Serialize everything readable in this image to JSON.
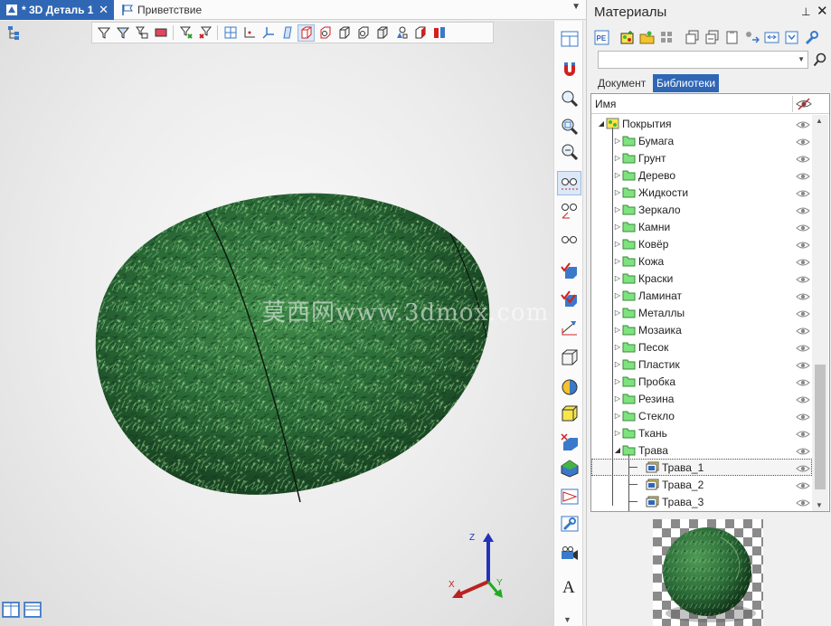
{
  "tabs": {
    "active_label": "* 3D Деталь 1",
    "close_glyph": "✕",
    "inactive_label": "Приветствие",
    "menu_glyph": "▼"
  },
  "viewport": {
    "watermark": "莫西网www.3dmox.com",
    "axes": {
      "x": "X",
      "y": "Y",
      "z": "Z"
    },
    "icons": [
      "filter-icon",
      "filter-2-icon",
      "filter-3-icon",
      "color-icon",
      "filter-clear-icon",
      "filter-clear-2-icon",
      "grid-icon",
      "axis-icon",
      "axis-3d-icon",
      "plane-icon",
      "cube-icon",
      "cube-2-icon",
      "cube-3-icon",
      "cube-4-icon",
      "cube-5-icon",
      "shapes-icon",
      "cube-6-icon",
      "section-icon"
    ]
  },
  "vtoolbar": {
    "icons": [
      "panel-layout-icon",
      "magnet-icon",
      "zoom-icon",
      "zoom-window-icon",
      "zoom-out-icon",
      "glasses-selected-icon",
      "glasses-edit-icon",
      "glasses-icon",
      "check-cube-icon",
      "check-cube-2-icon",
      "measure-icon",
      "wireframe-cube-icon",
      "sphere-color-icon",
      "yellow-cube-icon",
      "cut-icon",
      "shaded-cube-icon",
      "projection-icon",
      "settings-wrench-icon",
      "camera-icon",
      "text-icon"
    ]
  },
  "panel": {
    "title": "Материалы",
    "pin_glyph": "⊥",
    "close_glyph": "✕",
    "search": {
      "value": "",
      "placeholder": ""
    },
    "tab_document": "Документ",
    "tab_libraries": "Библиотеки",
    "column_name": "Имя",
    "tree": [
      {
        "label": "Покрытия",
        "level": 0,
        "expander": "◢",
        "type": "root"
      },
      {
        "label": "Бумага",
        "level": 1,
        "expander": "▷",
        "type": "folder"
      },
      {
        "label": "Грунт",
        "level": 1,
        "expander": "▷",
        "type": "folder"
      },
      {
        "label": "Дерево",
        "level": 1,
        "expander": "▷",
        "type": "folder"
      },
      {
        "label": "Жидкости",
        "level": 1,
        "expander": "▷",
        "type": "folder"
      },
      {
        "label": "Зеркало",
        "level": 1,
        "expander": "▷",
        "type": "folder"
      },
      {
        "label": "Камни",
        "level": 1,
        "expander": "▷",
        "type": "folder"
      },
      {
        "label": "Ковёр",
        "level": 1,
        "expander": "▷",
        "type": "folder"
      },
      {
        "label": "Кожа",
        "level": 1,
        "expander": "▷",
        "type": "folder"
      },
      {
        "label": "Краски",
        "level": 1,
        "expander": "▷",
        "type": "folder"
      },
      {
        "label": "Ламинат",
        "level": 1,
        "expander": "▷",
        "type": "folder"
      },
      {
        "label": "Металлы",
        "level": 1,
        "expander": "▷",
        "type": "folder"
      },
      {
        "label": "Мозаика",
        "level": 1,
        "expander": "▷",
        "type": "folder"
      },
      {
        "label": "Песок",
        "level": 1,
        "expander": "▷",
        "type": "folder"
      },
      {
        "label": "Пластик",
        "level": 1,
        "expander": "▷",
        "type": "folder"
      },
      {
        "label": "Пробка",
        "level": 1,
        "expander": "▷",
        "type": "folder"
      },
      {
        "label": "Резина",
        "level": 1,
        "expander": "▷",
        "type": "folder"
      },
      {
        "label": "Стекло",
        "level": 1,
        "expander": "▷",
        "type": "folder"
      },
      {
        "label": "Ткань",
        "level": 1,
        "expander": "▷",
        "type": "folder"
      },
      {
        "label": "Трава",
        "level": 1,
        "expander": "◢",
        "type": "folder"
      },
      {
        "label": "Трава_1",
        "level": 2,
        "expander": "",
        "type": "material",
        "selected": true
      },
      {
        "label": "Трава_2",
        "level": 2,
        "expander": "",
        "type": "material"
      },
      {
        "label": "Трава_3",
        "level": 2,
        "expander": "",
        "type": "material"
      }
    ],
    "toolbar_icons": [
      "properties-icon",
      "add-material-icon",
      "open-library-icon",
      "library-grid-icon",
      "copy-icon",
      "copy-2-icon",
      "paste-icon",
      "apply-icon",
      "replace-icon",
      "collapse-icon",
      "settings-icon"
    ]
  },
  "colors": {
    "accent": "#2f67b5",
    "folder": "#7ee27e",
    "grass_dark": "#1f4d2c",
    "grass_light": "#4f9a55"
  }
}
